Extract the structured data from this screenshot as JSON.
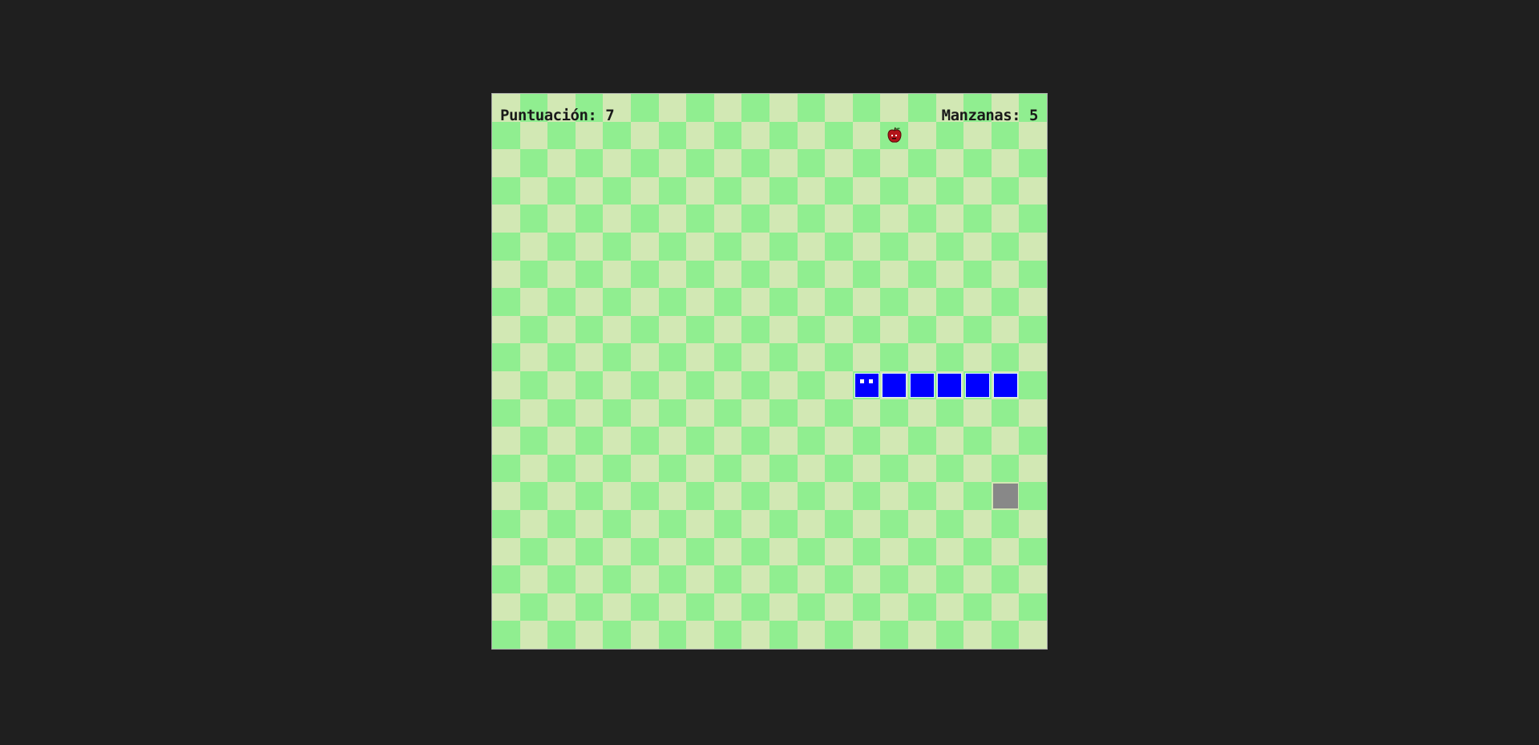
{
  "hud": {
    "score_label": "Puntuación: 7",
    "apples_label": "Manzanas: 5"
  },
  "game": {
    "cols": 20,
    "rows": 20,
    "snake": [
      [
        13,
        10
      ],
      [
        14,
        10
      ],
      [
        15,
        10
      ],
      [
        16,
        10
      ],
      [
        17,
        10
      ],
      [
        18,
        10
      ]
    ],
    "snake_direction": "left",
    "apple": [
      14,
      1
    ],
    "obstacle": [
      18,
      14
    ]
  },
  "colors": {
    "background": "#1f1f1f",
    "tile_light": "#d2e8b4",
    "tile_dark": "#90EE90",
    "snake": "#0000ff",
    "snake_border": "#d8f0ff",
    "snake_eye": "#ffffff",
    "obstacle": "#888888",
    "apple": "#b3141a"
  },
  "icons": {
    "apple": "apple-icon",
    "obstacle": "rock-block"
  }
}
